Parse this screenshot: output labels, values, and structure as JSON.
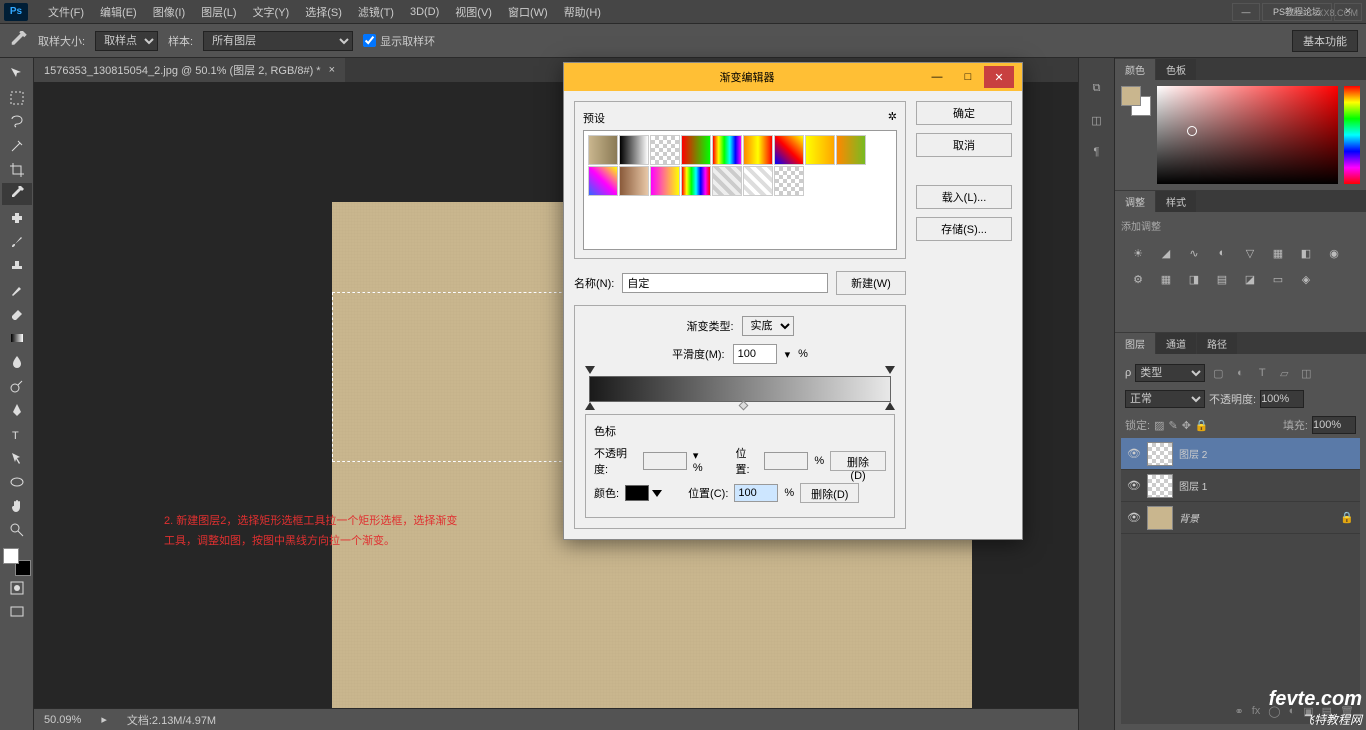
{
  "menubar": {
    "items": [
      "文件(F)",
      "编辑(E)",
      "图像(I)",
      "图层(L)",
      "文字(Y)",
      "选择(S)",
      "滤镜(T)",
      "3D(D)",
      "视图(V)",
      "窗口(W)",
      "帮助(H)"
    ],
    "watermark": "BBS.16XX8.COM",
    "wm_label": "PS教程论坛"
  },
  "optbar": {
    "sample_size_label": "取样大小:",
    "sample_size_value": "取样点",
    "sample_label": "样本:",
    "sample_value": "所有图层",
    "show_ring": "显示取样环",
    "basic": "基本功能"
  },
  "doc": {
    "tab": "1576353_130815054_2.jpg @ 50.1% (图层 2, RGB/8#) *"
  },
  "annotation": {
    "line1": "2. 新建图层2，选择矩形选框工具拉一个矩形选框，选择渐变",
    "line2": "工具，调整如图，按图中黑线方向拉一个渐变。"
  },
  "status": {
    "zoom": "50.09%",
    "docsize": "文档:2.13M/4.97M"
  },
  "panels": {
    "color_tab": "颜色",
    "swatch_tab": "色板",
    "adjust_tab": "调整",
    "style_tab": "样式",
    "adjust_label": "添加调整",
    "layers_tab": "图层",
    "channels_tab": "通道",
    "paths_tab": "路径",
    "kind": "类型",
    "blend": "正常",
    "opacity_label": "不透明度:",
    "opacity_val": "100%",
    "lock_label": "锁定:",
    "fill_label": "填充:",
    "fill_val": "100%",
    "layers": [
      {
        "name": "图层 2",
        "selected": true,
        "thumb": "checker"
      },
      {
        "name": "图层 1",
        "selected": false,
        "thumb": "checker"
      },
      {
        "name": "背景",
        "selected": false,
        "thumb": "paper",
        "locked": true
      }
    ]
  },
  "dialog": {
    "title": "渐变编辑器",
    "presets_label": "预设",
    "gear": "✲",
    "ok": "确定",
    "cancel": "取消",
    "load": "载入(L)...",
    "save": "存储(S)...",
    "name_label": "名称(N):",
    "name_value": "自定",
    "new_btn": "新建(W)",
    "type_label": "渐变类型:",
    "type_value": "实底",
    "smooth_label": "平滑度(M):",
    "smooth_value": "100",
    "stops_title": "色标",
    "opacity_label": "不透明度:",
    "position_label": "位置:",
    "position2_label": "位置(C):",
    "position2_value": "100",
    "color_label": "颜色:",
    "delete": "删除(D)"
  },
  "watermark": {
    "big": "fevte.com",
    "sm": "飞特教程网"
  }
}
